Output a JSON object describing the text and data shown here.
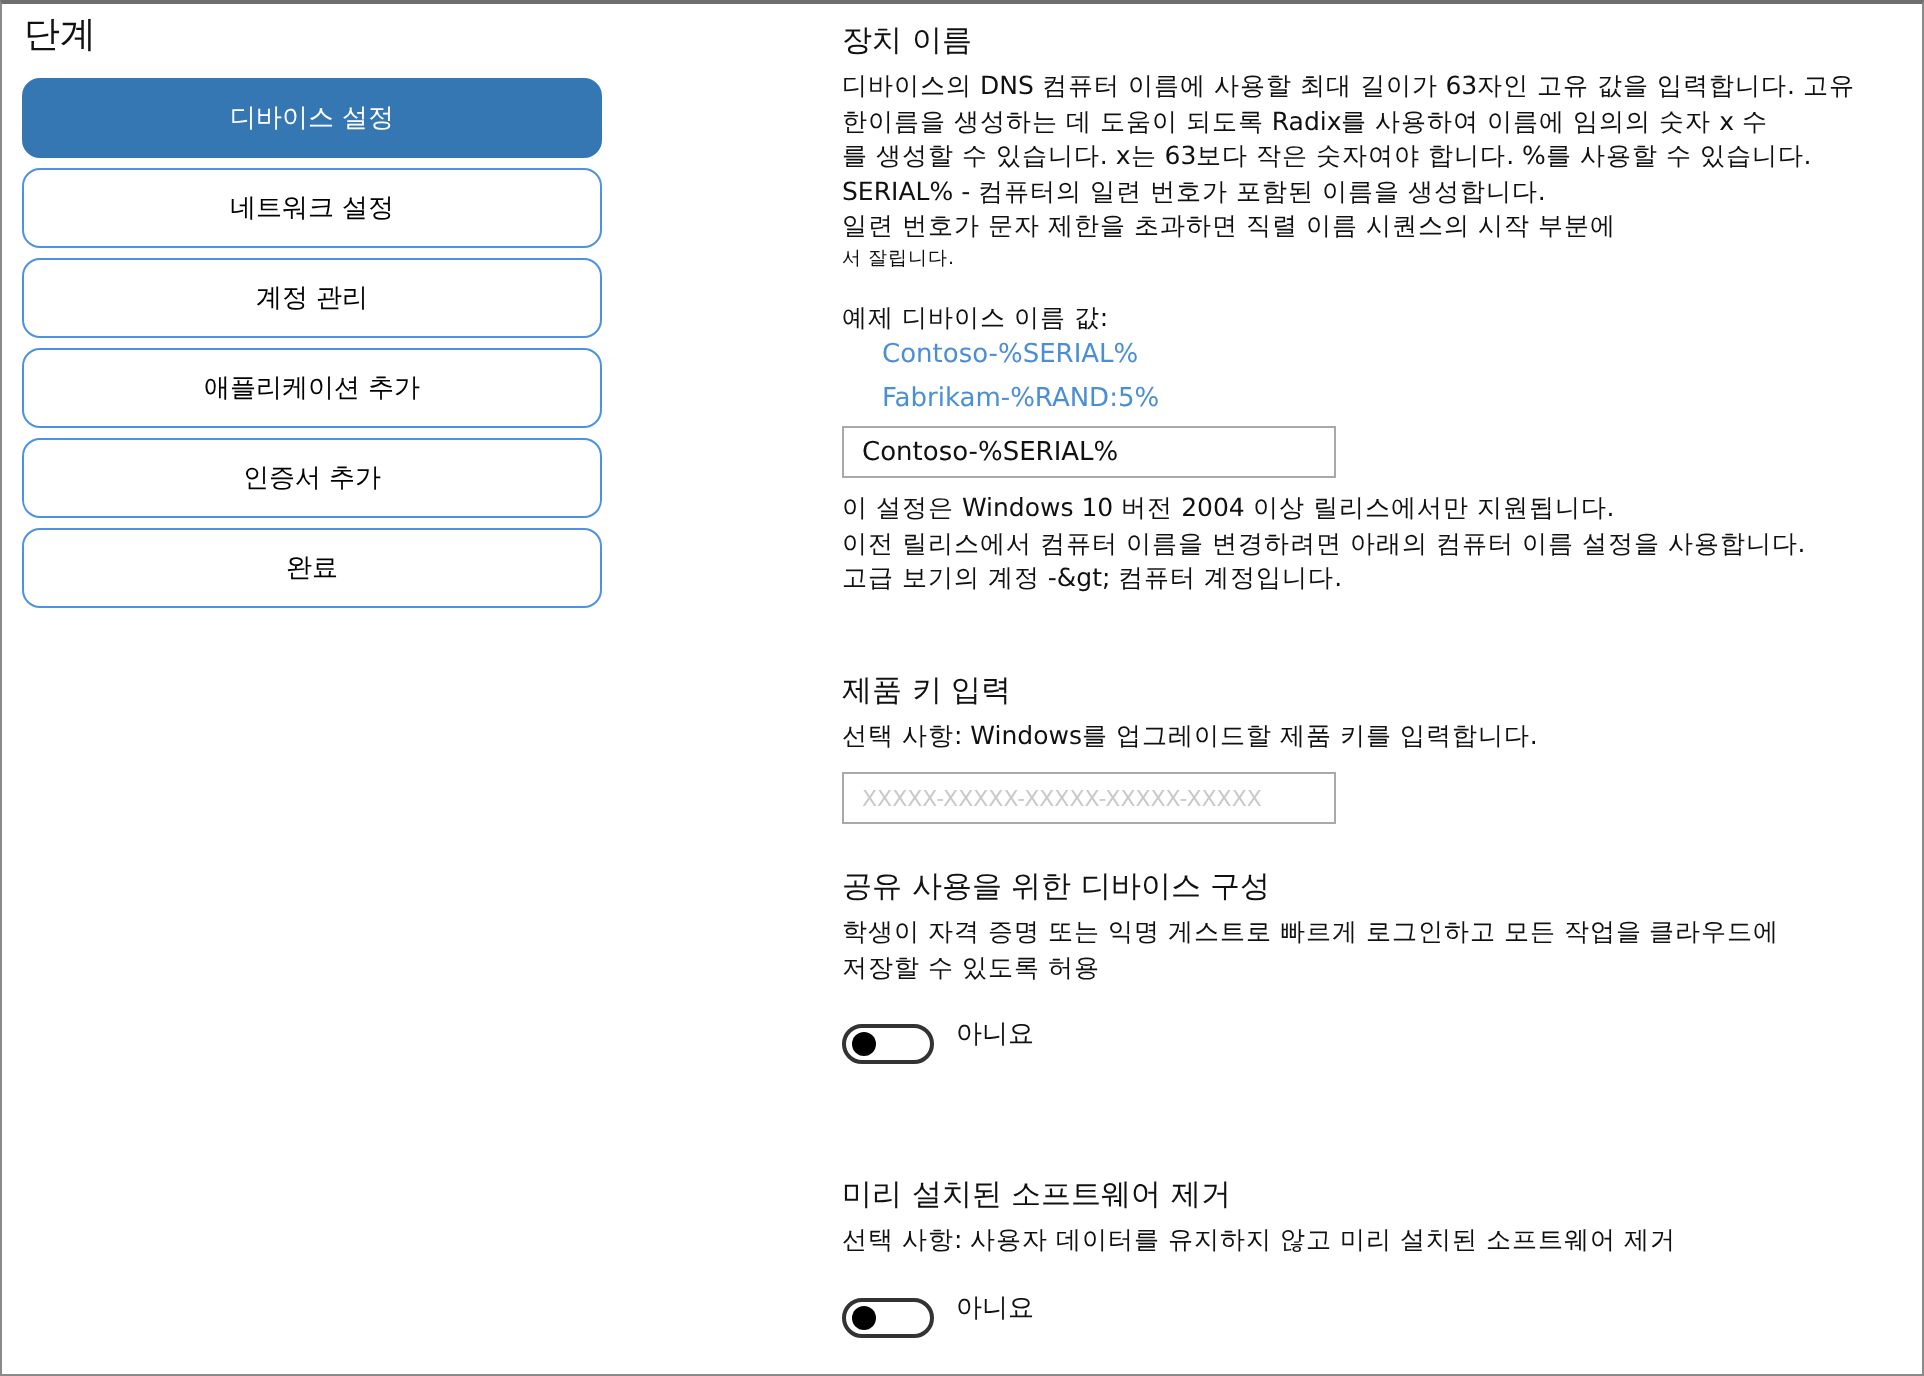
{
  "sidebar": {
    "title": "단계",
    "steps": [
      {
        "label": "디바이스 설정",
        "selected": true
      },
      {
        "label": "네트워크 설정",
        "selected": false
      },
      {
        "label": "계정 관리",
        "selected": false
      },
      {
        "label": "애플리케이션 추가",
        "selected": false
      },
      {
        "label": "인증서 추가",
        "selected": false
      },
      {
        "label": "완료",
        "selected": false
      }
    ]
  },
  "sections": [
    {
      "heading": "장치 이름",
      "blocks": [
        {
          "kind": "text",
          "text": "디바이스의 DNS 컴퓨터 이름에 사용할 최대 길이가 63자인 고유 값을 입력합니다. 고유\n한이름을 생성하는 데 도움이 되도록 Radix를 사용하여 이름에 임의의 숫자 x 수\n를 생성할 수 있습니다. x는 63보다 작은 숫자여야 합니다. %를 사용할 수 있습니다.\nSERIAL% - 컴퓨터의 일련 번호가 포함된 이름을 생성합니다.\n일련 번호가 문자 제한을 초과하면 직렬 이름 시퀀스의 시작 부분에"
        },
        {
          "kind": "small_text",
          "text": "서 잘립니다."
        },
        {
          "kind": "text",
          "text": "예제 디바이스 이름 값:"
        },
        {
          "kind": "link",
          "text": "Contoso-%SERIAL%"
        },
        {
          "kind": "link",
          "text": "Fabrikam-%RAND:5%"
        },
        {
          "kind": "field",
          "value": "Contoso-%SERIAL%"
        },
        {
          "kind": "text",
          "text": "이 설정은 Windows 10 버전 2004 이상 릴리스에서만 지원됩니다.\n이전 릴리스에서 컴퓨터 이름을 변경하려면 아래의 컴퓨터 이름 설정을 사용합니다.\n고급 보기의 계정 -&gt; 컴퓨터 계정입니다."
        }
      ]
    },
    {
      "heading": "제품 키 입력",
      "blocks": [
        {
          "kind": "text",
          "text": "선택 사항: Windows를 업그레이드할 제품 키를 입력합니다."
        },
        {
          "kind": "field",
          "placeholder": "XXXXX-XXXXX-XXXXX-XXXXX-XXXXX"
        }
      ]
    },
    {
      "heading": "공유 사용을 위한 디바이스 구성",
      "blocks": [
        {
          "kind": "text",
          "text": "학생이 자격 증명 또는 익명 게스트로 빠르게 로그인하고 모든 작업을 클라우드에\n저장할 수 있도록 허용"
        },
        {
          "kind": "toggle",
          "on": false,
          "state_label": "아니요"
        }
      ]
    },
    {
      "heading": "미리 설치된 소프트웨어 제거",
      "blocks": [
        {
          "kind": "text",
          "text": "선택 사항: 사용자 데이터를 유지하지 않고 미리 설치된 소프트웨어 제거"
        },
        {
          "kind": "toggle",
          "on": false,
          "state_label": "아니요"
        }
      ]
    }
  ]
}
